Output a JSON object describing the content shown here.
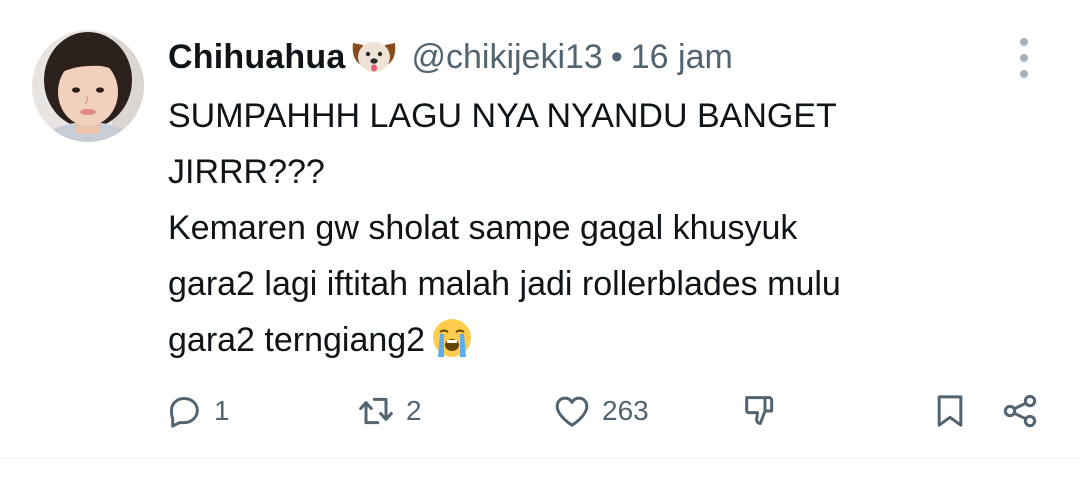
{
  "tweet": {
    "display_name": "Chihuahua",
    "name_emoji": "dog-face-emoji",
    "handle": "@chikijeki13",
    "separator": "•",
    "time": "16 jam",
    "lines": [
      "SUMPAHHH LAGU NYA NYANDU BANGET",
      "JIRRR???",
      "Kemaren gw sholat sampe gagal khusyuk",
      "gara2 lagi iftitah malah jadi rollerblades mulu",
      "gara2 terngiang2"
    ],
    "trailing_emoji": "loudly-crying-face-emoji"
  },
  "actions": {
    "reply_count": "1",
    "retweet_count": "2",
    "like_count": "263"
  },
  "icons": {
    "more": "more-vertical-icon",
    "reply": "reply-icon",
    "retweet": "retweet-icon",
    "like": "heart-icon",
    "downvote": "thumbs-down-icon",
    "bookmark": "bookmark-icon",
    "share": "share-icon"
  },
  "colors": {
    "text": "#0f1419",
    "secondary": "#536471",
    "divider": "#eff3f4"
  }
}
